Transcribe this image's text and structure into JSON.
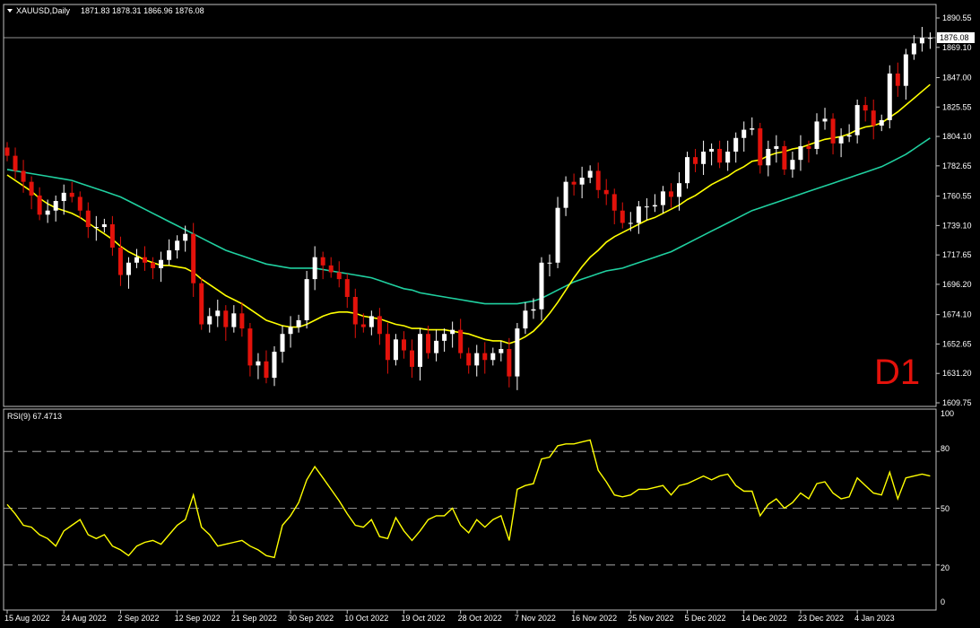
{
  "header": {
    "symbol": "XAUUSD,Daily",
    "ohlc": "1871.83 1878.31 1866.96 1876.08",
    "menu_icon": "triangle-down-icon"
  },
  "timeframe_label": "D1",
  "current_price_label": "1876.08",
  "rsi": {
    "title": "RSI(9) 67.4713",
    "levels": [
      "100",
      "80",
      "50",
      "20",
      "0"
    ]
  },
  "colors": {
    "background": "#000000",
    "bull_candle": "#ffffff",
    "bear_candle": "#e3120b",
    "ma_fast": "#ffff00",
    "ma_slow": "#20d0a0",
    "rsi_line": "#ffff00",
    "grid": "#c0c0c0"
  },
  "chart_data": [
    {
      "type": "candlestick",
      "title": "XAUUSD,Daily",
      "price_axis_labels": [
        "1890.55",
        "1869.10",
        "1847.00",
        "1825.55",
        "1804.10",
        "1782.65",
        "1760.55",
        "1739.10",
        "1717.65",
        "1696.20",
        "1674.10",
        "1652.65",
        "1631.20",
        "1609.75"
      ],
      "ylim": [
        1605,
        1895
      ],
      "date_labels": [
        "15 Aug 2022",
        "24 Aug 2022",
        "2 Sep 2022",
        "12 Sep 2022",
        "21 Sep 2022",
        "30 Sep 2022",
        "10 Oct 2022",
        "19 Oct 2022",
        "28 Oct 2022",
        "7 Nov 2022",
        "16 Nov 2022",
        "25 Nov 2022",
        "5 Dec 2022",
        "14 Dec 2022",
        "23 Dec 2022",
        "4 Jan 2023"
      ],
      "close": [
        1790,
        1779,
        1771,
        1761,
        1747,
        1750,
        1757,
        1763,
        1760,
        1750,
        1738,
        1738,
        1740,
        1723,
        1703,
        1712,
        1716,
        1712,
        1708,
        1714,
        1721,
        1728,
        1733,
        1697,
        1667,
        1673,
        1677,
        1665,
        1675,
        1664,
        1637,
        1640,
        1628,
        1647,
        1660,
        1665,
        1670,
        1700,
        1716,
        1710,
        1705,
        1700,
        1687,
        1667,
        1665,
        1673,
        1660,
        1641,
        1656,
        1648,
        1636,
        1660,
        1646,
        1655,
        1660,
        1663,
        1646,
        1637,
        1646,
        1641,
        1646,
        1649,
        1629,
        1664,
        1677,
        1678,
        1712,
        1712,
        1752,
        1771,
        1769,
        1774,
        1779,
        1765,
        1762,
        1750,
        1741,
        1741,
        1753,
        1753,
        1754,
        1764,
        1760,
        1770,
        1789,
        1784,
        1793,
        1795,
        1785,
        1793,
        1803,
        1809,
        1810,
        1783,
        1795,
        1797,
        1780,
        1787,
        1797,
        1795,
        1815,
        1817,
        1799,
        1804,
        1805,
        1827,
        1823,
        1812,
        1816,
        1850,
        1841,
        1864,
        1872,
        1876,
        1876
      ],
      "ma_fast": [
        1776,
        1772,
        1768,
        1764,
        1759,
        1755,
        1752,
        1750,
        1748,
        1745,
        1741,
        1737,
        1733,
        1729,
        1724,
        1720,
        1717,
        1714,
        1712,
        1710,
        1710,
        1709,
        1708,
        1705,
        1700,
        1696,
        1692,
        1688,
        1685,
        1682,
        1678,
        1674,
        1670,
        1668,
        1666,
        1665,
        1665,
        1667,
        1670,
        1673,
        1675,
        1676,
        1676,
        1675,
        1673,
        1672,
        1671,
        1669,
        1667,
        1666,
        1664,
        1664,
        1663,
        1663,
        1663,
        1662,
        1661,
        1660,
        1658,
        1656,
        1655,
        1655,
        1653,
        1655,
        1658,
        1662,
        1668,
        1675,
        1683,
        1692,
        1701,
        1709,
        1716,
        1721,
        1727,
        1731,
        1734,
        1737,
        1740,
        1743,
        1745,
        1748,
        1751,
        1754,
        1758,
        1761,
        1765,
        1769,
        1772,
        1775,
        1779,
        1782,
        1786,
        1787,
        1790,
        1792,
        1793,
        1795,
        1796,
        1798,
        1800,
        1802,
        1803,
        1804,
        1806,
        1809,
        1811,
        1812,
        1814,
        1818,
        1822,
        1827,
        1832,
        1837,
        1842
      ],
      "ma_slow": [
        1780,
        1779,
        1778,
        1777,
        1776,
        1775,
        1774,
        1773,
        1772,
        1770,
        1768,
        1766,
        1764,
        1762,
        1760,
        1757,
        1754,
        1751,
        1748,
        1745,
        1742,
        1739,
        1736,
        1733,
        1730,
        1727,
        1724,
        1721,
        1719,
        1717,
        1715,
        1713,
        1711,
        1710,
        1709,
        1708,
        1708,
        1708,
        1708,
        1707,
        1706,
        1705,
        1704,
        1703,
        1702,
        1701,
        1699,
        1697,
        1695,
        1693,
        1692,
        1690,
        1689,
        1688,
        1687,
        1686,
        1685,
        1684,
        1683,
        1682,
        1682,
        1682,
        1682,
        1682,
        1683,
        1684,
        1686,
        1689,
        1692,
        1695,
        1698,
        1700,
        1702,
        1704,
        1706,
        1707,
        1708,
        1710,
        1712,
        1714,
        1716,
        1718,
        1720,
        1723,
        1726,
        1729,
        1732,
        1735,
        1738,
        1741,
        1744,
        1747,
        1750,
        1752,
        1754,
        1756,
        1758,
        1760,
        1762,
        1764,
        1766,
        1768,
        1770,
        1772,
        1774,
        1776,
        1778,
        1780,
        1782,
        1785,
        1788,
        1791,
        1795,
        1799,
        1803
      ]
    },
    {
      "type": "line",
      "title": "RSI(9) 67.4713",
      "ylim": [
        0,
        100
      ],
      "levels": [
        80,
        50,
        20
      ],
      "values": [
        52,
        47,
        41,
        40,
        36,
        34,
        30,
        38,
        41,
        44,
        36,
        34,
        36,
        30,
        28,
        25,
        30,
        32,
        33,
        31,
        36,
        41,
        44,
        57,
        40,
        36,
        30,
        31,
        32,
        33,
        30,
        28,
        25,
        24,
        41,
        46,
        53,
        65,
        72,
        66,
        60,
        54,
        47,
        41,
        40,
        44,
        35,
        34,
        45,
        38,
        33,
        38,
        44,
        46,
        46,
        50,
        41,
        37,
        44,
        40,
        44,
        46,
        33,
        60,
        62,
        63,
        76,
        77,
        83,
        84,
        84,
        85,
        86,
        70,
        64,
        57,
        56,
        57,
        60,
        60,
        61,
        62,
        57,
        62,
        63,
        65,
        67,
        65,
        67,
        68,
        62,
        59,
        59,
        46,
        52,
        55,
        50,
        53,
        58,
        55,
        63,
        64,
        58,
        55,
        56,
        66,
        62,
        58,
        57,
        69,
        55,
        66,
        67,
        68,
        67
      ]
    }
  ]
}
